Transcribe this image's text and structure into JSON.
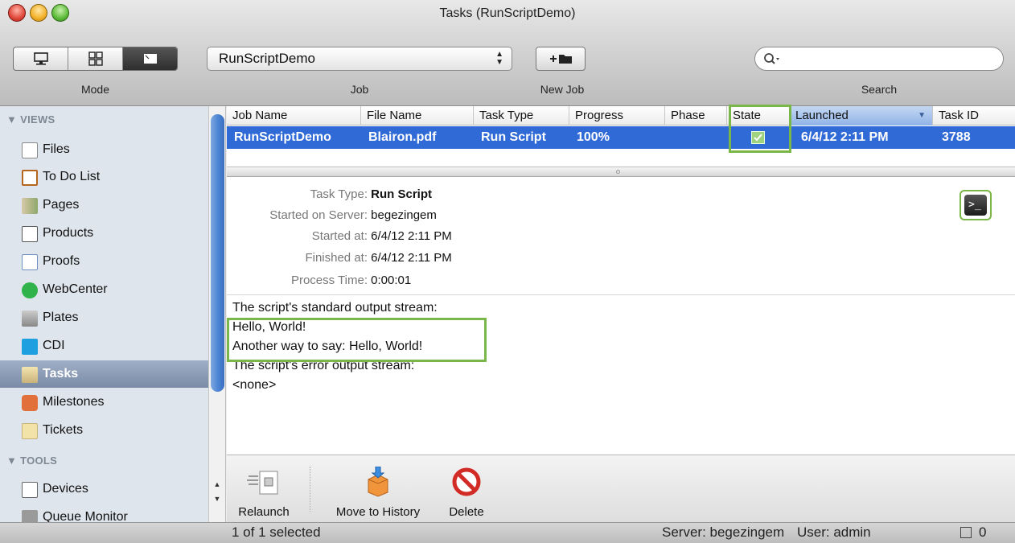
{
  "window": {
    "title": "Tasks (RunScriptDemo)"
  },
  "toolbar": {
    "mode_label": "Mode",
    "job_label": "Job",
    "job_value": "RunScriptDemo",
    "new_job_label": "New Job",
    "search_label": "Search",
    "search_value": ""
  },
  "sidebar": {
    "views_header": "VIEWS",
    "tools_header": "TOOLS",
    "items": [
      {
        "label": "Files",
        "icon": "file-icon"
      },
      {
        "label": "To Do List",
        "icon": "todo-icon"
      },
      {
        "label": "Pages",
        "icon": "pages-icon"
      },
      {
        "label": "Products",
        "icon": "products-icon"
      },
      {
        "label": "Proofs",
        "icon": "proofs-icon"
      },
      {
        "label": "WebCenter",
        "icon": "webcenter-icon"
      },
      {
        "label": "Plates",
        "icon": "plates-icon"
      },
      {
        "label": "CDI",
        "icon": "cdi-icon"
      },
      {
        "label": "Tasks",
        "icon": "tasks-icon"
      },
      {
        "label": "Milestones",
        "icon": "milestones-icon"
      },
      {
        "label": "Tickets",
        "icon": "tickets-icon"
      }
    ],
    "tools": [
      {
        "label": "Devices",
        "icon": "devices-icon"
      },
      {
        "label": "Queue Monitor",
        "icon": "queue-monitor-icon"
      }
    ]
  },
  "table": {
    "columns": [
      "Job Name",
      "File Name",
      "Task Type",
      "Progress",
      "Phase",
      "State",
      "Launched",
      "Task ID"
    ],
    "rows": [
      {
        "job_name": "RunScriptDemo",
        "file_name": "Blairon.pdf",
        "task_type": "Run Script",
        "progress": "100%",
        "phase": "",
        "state": "done",
        "launched": "6/4/12 2:11 PM",
        "task_id": "3788"
      }
    ]
  },
  "detail": {
    "task_type_key": "Task Type:",
    "task_type_value": "Run Script",
    "started_on_server_key": "Started on Server:",
    "started_on_server_value": "begezingem",
    "started_at_key": "Started at:",
    "started_at_value": "6/4/12 2:11 PM",
    "finished_at_key": "Finished at:",
    "finished_at_value": "6/4/12 2:11 PM",
    "process_time_key": "Process Time:",
    "process_time_value": "0:00:01",
    "output": [
      "The script's standard output stream:",
      "Hello, World!",
      "Another way to say: Hello, World!",
      "The script's error output stream:",
      "<none>"
    ]
  },
  "actions": {
    "relaunch": "Relaunch",
    "move_to_history": "Move to History",
    "delete": "Delete"
  },
  "status": {
    "selection": "1 of 1 selected",
    "server": "Server: begezingem",
    "user": "User: admin",
    "tasks_count": "0"
  },
  "colors": {
    "selection_blue": "#2f6ad7",
    "highlight_green": "#7ab648",
    "sidebar_bg": "#dfe5ec"
  }
}
